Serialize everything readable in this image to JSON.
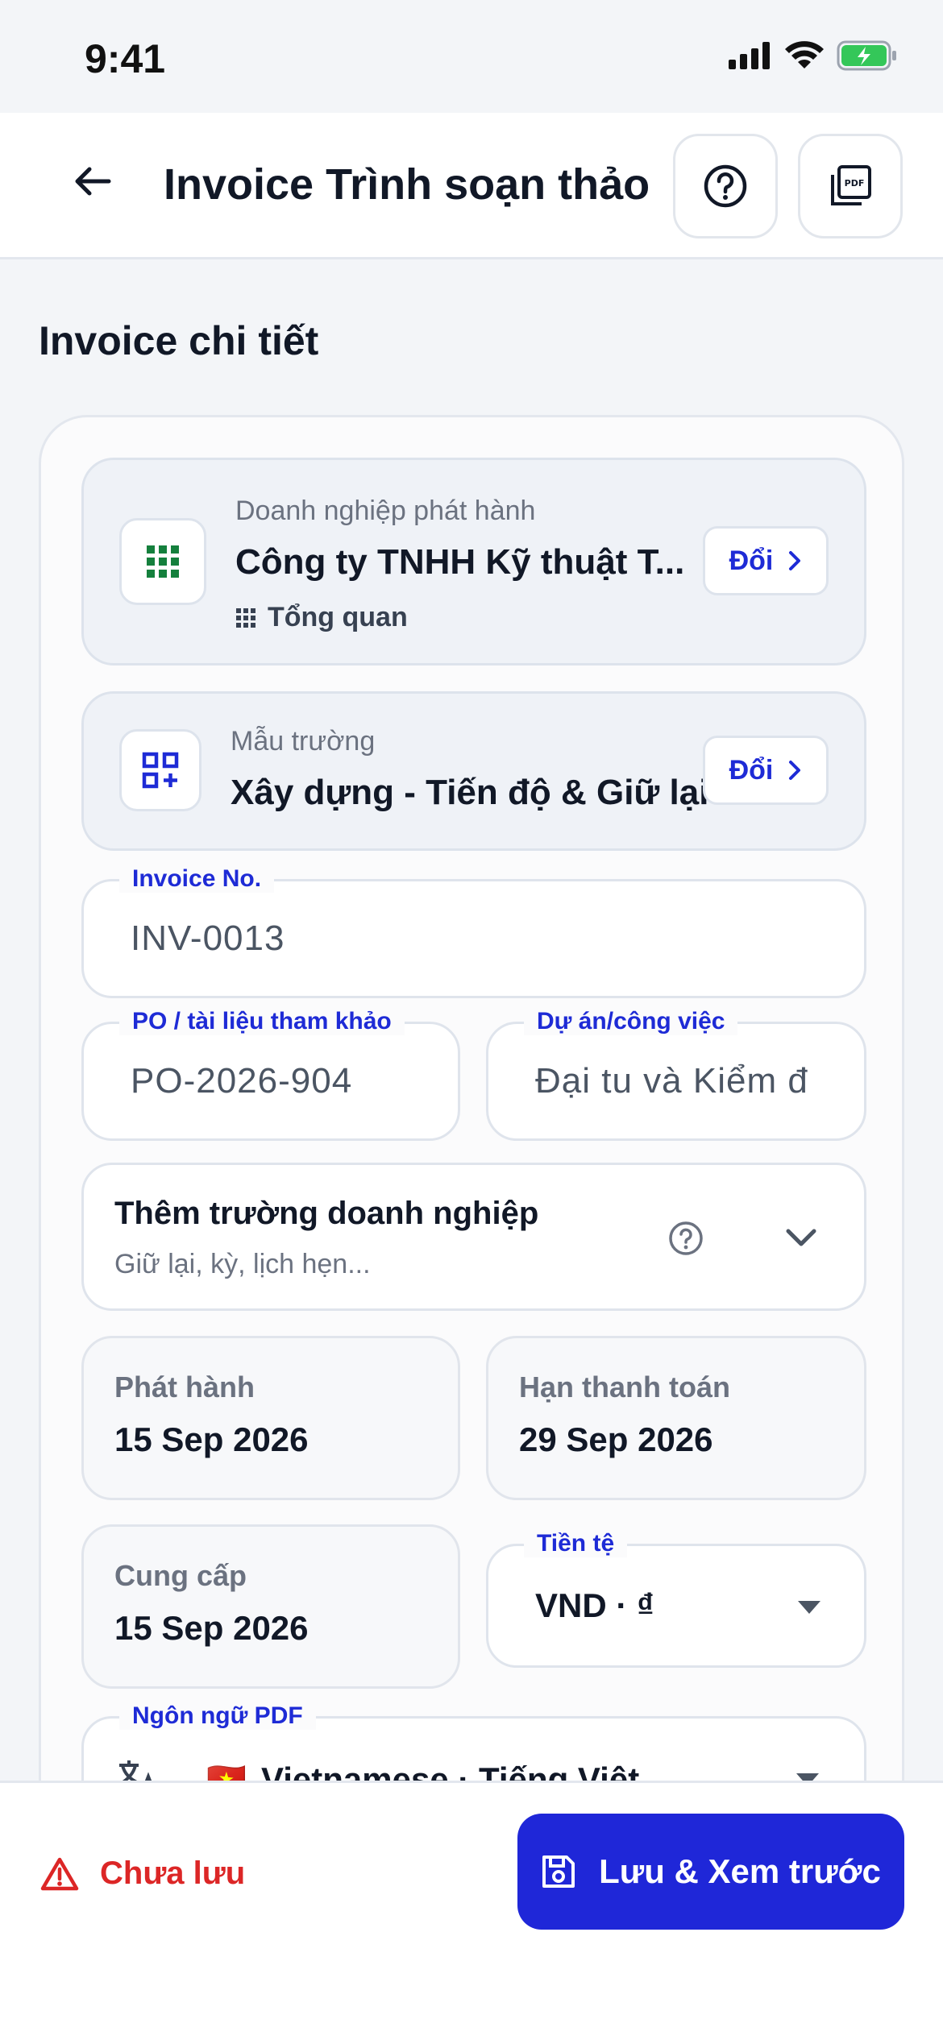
{
  "status_bar": {
    "time": "9:41"
  },
  "header": {
    "title": "Invoice Trình soạn thảo",
    "back_icon": "arrow-left-icon",
    "help_icon": "question-circle-icon",
    "pdf_icon": "pdf-document-icon"
  },
  "section": {
    "title": "Invoice chi tiết"
  },
  "business": {
    "label": "Doanh nghiệp phát hành",
    "name": "Công ty TNHH Kỹ thuật T...",
    "sub": "Tổng quan",
    "change_label": "Đổi"
  },
  "template": {
    "label": "Mẫu trường",
    "name": "Xây dựng - Tiến độ & Giữ lại",
    "change_label": "Đổi"
  },
  "fields": {
    "invoice_no": {
      "label": "Invoice No.",
      "value": "INV-0013"
    },
    "po_ref": {
      "label": "PO / tài liệu tham khảo",
      "value": "PO-2026-904"
    },
    "project": {
      "label": "Dự án/công việc",
      "value": "Đại tu và Kiểm đ"
    }
  },
  "business_fields": {
    "title": "Thêm trường doanh nghiệp",
    "subtitle": "Giữ lại, kỳ, lịch hẹn..."
  },
  "dates": {
    "issue": {
      "label": "Phát hành",
      "value": "15 Sep 2026"
    },
    "due": {
      "label": "Hạn thanh toán",
      "value": "29 Sep 2026"
    },
    "supply": {
      "label": "Cung cấp",
      "value": "15 Sep 2026"
    }
  },
  "currency": {
    "label": "Tiền tệ",
    "value": "VND · ₫"
  },
  "pdf_language": {
    "label": "Ngôn ngữ PDF",
    "value": "Vietnamese · Tiếng Việt",
    "flag": "🇻🇳"
  },
  "footer": {
    "unsaved_label": "Chưa lưu",
    "save_label": "Lưu & Xem trước"
  },
  "colors": {
    "accent": "#1f27d8",
    "warning": "#dc2626",
    "green_icon": "#15803d"
  }
}
